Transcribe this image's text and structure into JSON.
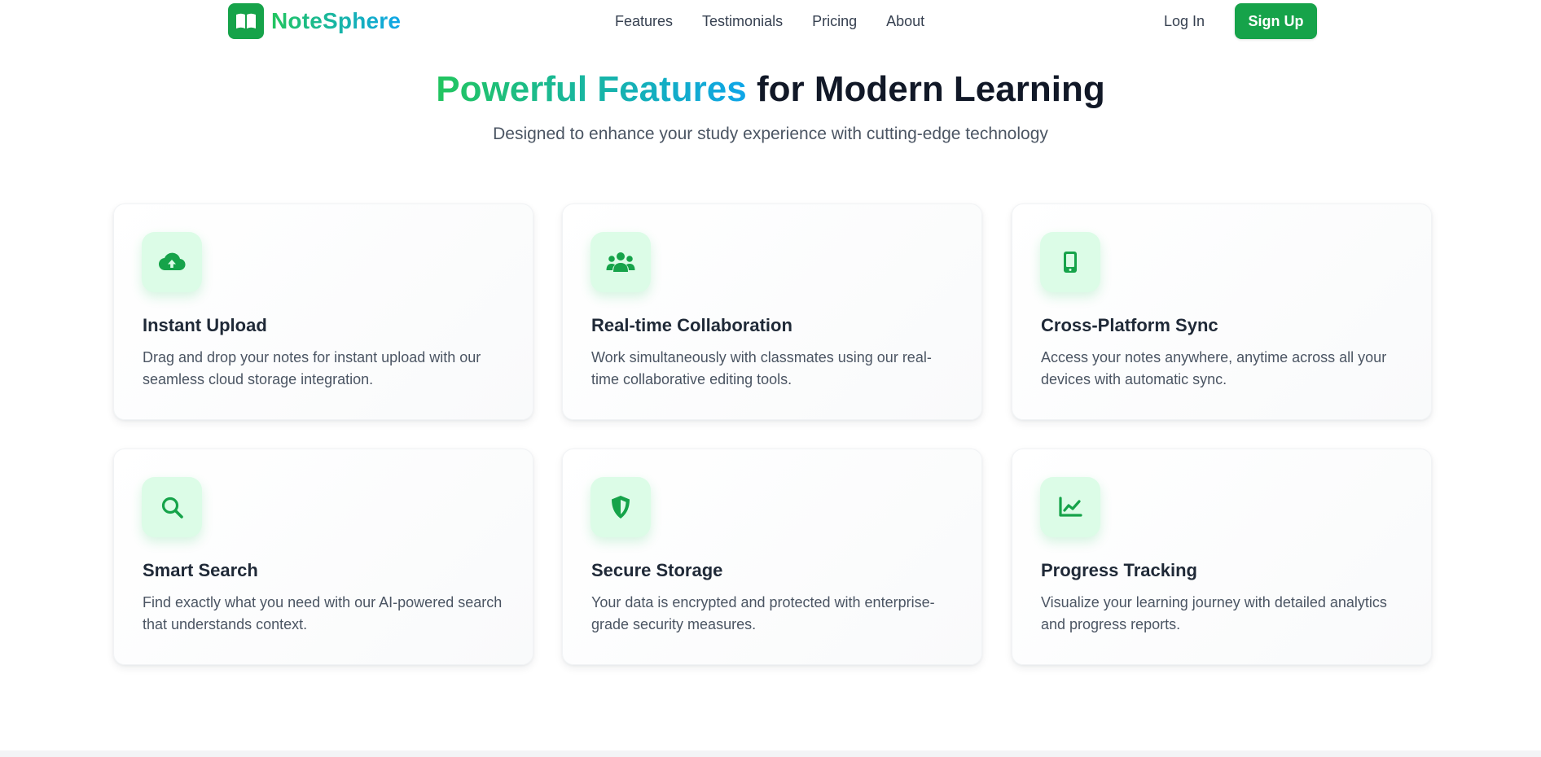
{
  "brand": {
    "name": "NoteSphere",
    "logo_icon": "book-open-icon"
  },
  "nav": {
    "links": [
      "Features",
      "Testimonials",
      "Pricing",
      "About"
    ],
    "login_label": "Log In",
    "signup_label": "Sign Up"
  },
  "hero": {
    "title_highlight": "Powerful Features",
    "title_rest": " for Modern Learning",
    "subtitle": "Designed to enhance your study experience with cutting-edge technology"
  },
  "features": [
    {
      "icon": "cloud-upload-icon",
      "title": "Instant Upload",
      "description": "Drag and drop your notes for instant upload with our seamless cloud storage integration."
    },
    {
      "icon": "users-icon",
      "title": "Real-time Collaboration",
      "description": "Work simultaneously with classmates using our real-time collaborative editing tools."
    },
    {
      "icon": "tablet-icon",
      "title": "Cross-Platform Sync",
      "description": "Access your notes anywhere, anytime across all your devices with automatic sync."
    },
    {
      "icon": "search-icon",
      "title": "Smart Search",
      "description": "Find exactly what you need with our AI-powered search that understands context."
    },
    {
      "icon": "shield-icon",
      "title": "Secure Storage",
      "description": "Your data is encrypted and protected with enterprise-grade security measures."
    },
    {
      "icon": "chart-line-icon",
      "title": "Progress Tracking",
      "description": "Visualize your learning journey with detailed analytics and progress reports."
    }
  ],
  "colors": {
    "brand_green": "#16a34a",
    "gradient_start": "#22c55e",
    "gradient_end": "#0ea5e9",
    "icon_bg": "#dcfce7"
  }
}
